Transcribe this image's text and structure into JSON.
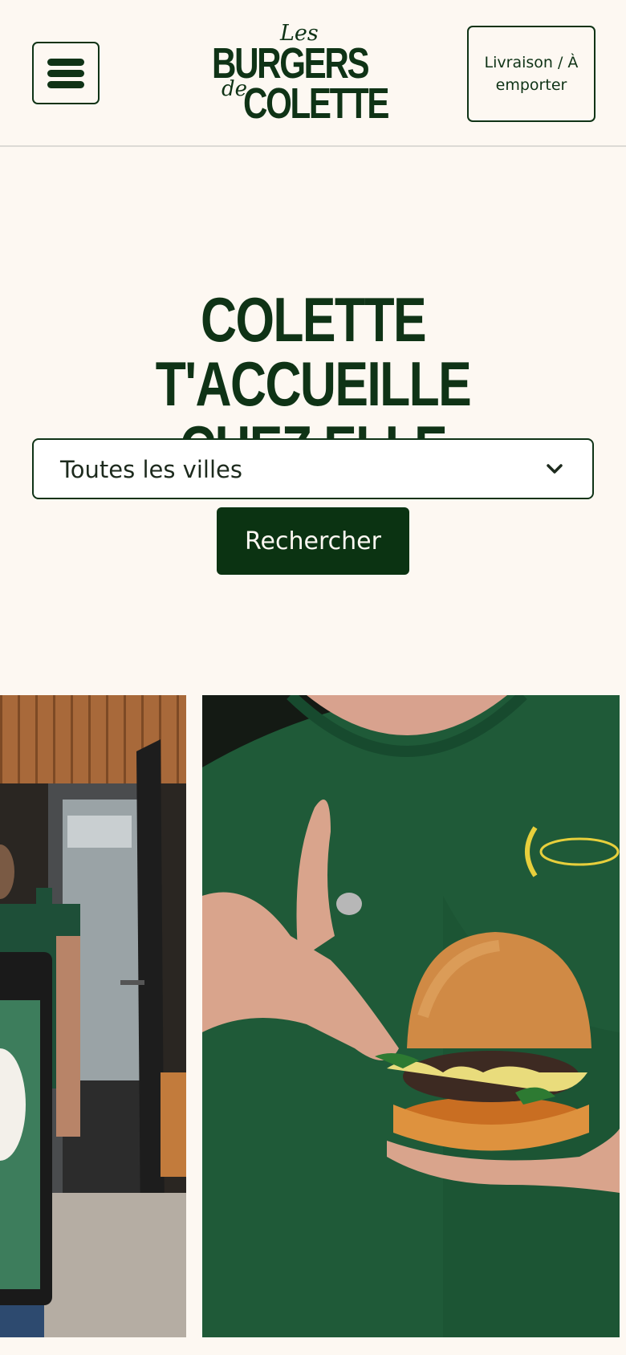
{
  "header": {
    "menu_button": {
      "icon": "burger-menu-icon"
    },
    "logo": {
      "line1": "Les",
      "line2": "BURGERS",
      "line3_small": "de",
      "line3": "COLETTE"
    },
    "delivery_button_label": "Livraison / À emporter"
  },
  "hero": {
    "title": "COLETTE T'ACCUEILLE CHEZ ELLE",
    "city_select": {
      "value": "Toutes les villes",
      "icon": "chevron-down-icon"
    },
    "search_button_label": "Rechercher"
  },
  "gallery": {
    "images": [
      {
        "subject": "staff-members-at-restaurant-entrance"
      },
      {
        "subject": "person-in-green-shirt-holding-burger"
      }
    ]
  },
  "colors": {
    "brand_green": "#0f3316",
    "button_green": "#0b3312",
    "background": "#fdf8f2",
    "shirt_green": "#1f5a38",
    "logo_yellow": "#e7cf3c"
  }
}
